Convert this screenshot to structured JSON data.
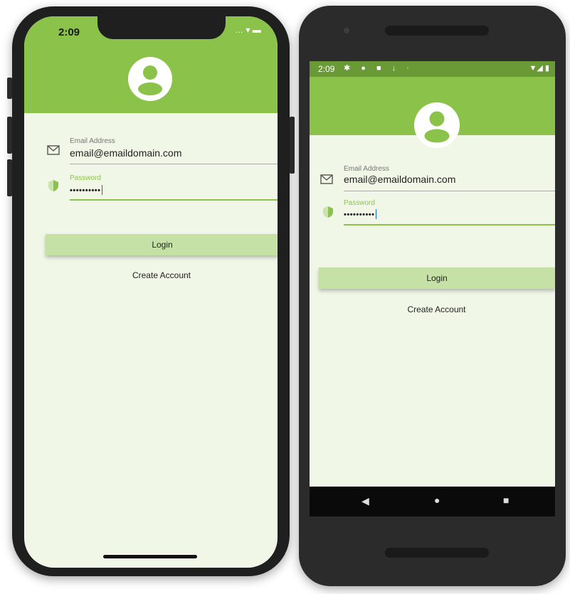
{
  "ios": {
    "status_time": "2:09",
    "status_right": "… ▾ ▬",
    "form": {
      "email_label": "Email Address",
      "email_value": "email@emaildomain.com",
      "password_label": "Password",
      "password_value": "••••••••••",
      "login_label": "Login",
      "create_account_label": "Create Account"
    }
  },
  "android": {
    "status_time": "2:09",
    "status_icons": "✱ ● ■ ↓ ·",
    "status_right": "▼◢ ▮",
    "form": {
      "email_label": "Email Address",
      "email_value": "email@emaildomain.com",
      "password_label": "Password",
      "password_value": "••••••••••",
      "login_label": "Login",
      "create_account_label": "Create Account"
    },
    "nav": {
      "back": "◀",
      "home": "●",
      "recents": "■"
    }
  },
  "colors": {
    "header": "#8bc34a",
    "screen_background": "#f1f7e7",
    "button": "#c5e1a5",
    "accent": "#8bc34a",
    "android_status_bar": "#6a9a35"
  },
  "icons": [
    "account-circle-icon",
    "mail-icon",
    "shield-icon",
    "wifi-icon",
    "battery-icon",
    "signal-icon"
  ]
}
